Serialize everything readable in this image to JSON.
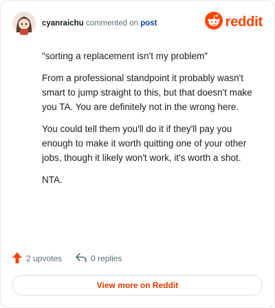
{
  "header": {
    "username": "cyanraichu",
    "action_text": "commented on",
    "post_link": "post",
    "brand": "reddit"
  },
  "comment": {
    "paragraphs": [
      "\"sorting a replacement isn't my problem\"",
      "From a professional standpoint it probably wasn't smart to jump straight to this, but that doesn't make you TA. You are definitely not in the wrong here.",
      "You could tell them you'll do it if they'll pay you enough to make it worth quitting one of your other jobs, though it likely won't work, it's worth a shot.",
      "NTA."
    ]
  },
  "footer": {
    "upvotes": "2 upvotes",
    "replies": "0 replies",
    "view_more": "View more on Reddit"
  },
  "colors": {
    "brand_orange": "#ff4500",
    "upvote_orange": "#ff4500",
    "link_blue": "#0a449b",
    "button_text": "#d93a00"
  },
  "icons": {
    "avatar": "avatar",
    "brand": "reddit-snoo-icon",
    "upvote": "upvote-arrow-icon",
    "reply": "reply-arrow-icon"
  }
}
